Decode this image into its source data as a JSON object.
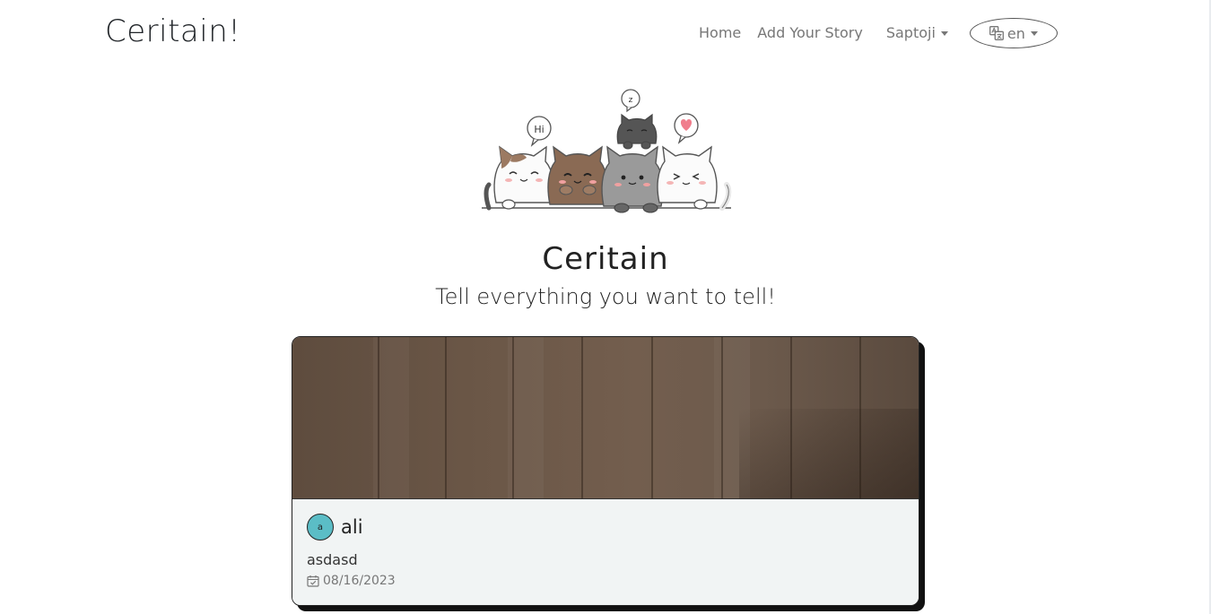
{
  "navbar": {
    "brand": "Ceritain!",
    "links": {
      "home": "Home",
      "add_story": "Add Your Story",
      "user": "Saptoji"
    },
    "language": {
      "selected": "en",
      "icon": "translate-icon"
    }
  },
  "hero": {
    "title": "Ceritain",
    "subtitle": "Tell everything you want to tell!",
    "bubbles": {
      "hi": "Hi",
      "sleep": "z"
    }
  },
  "stories": [
    {
      "avatar_initial": "a",
      "author": "ali",
      "description": "asdasd",
      "date": "08/16/2023",
      "date_icon": "calendar-check-icon"
    }
  ],
  "colors": {
    "avatar": "#5bbdc6",
    "card_body": "#f1f4f4",
    "nav_text": "#777777",
    "card_image_wood": "#6b5747"
  }
}
